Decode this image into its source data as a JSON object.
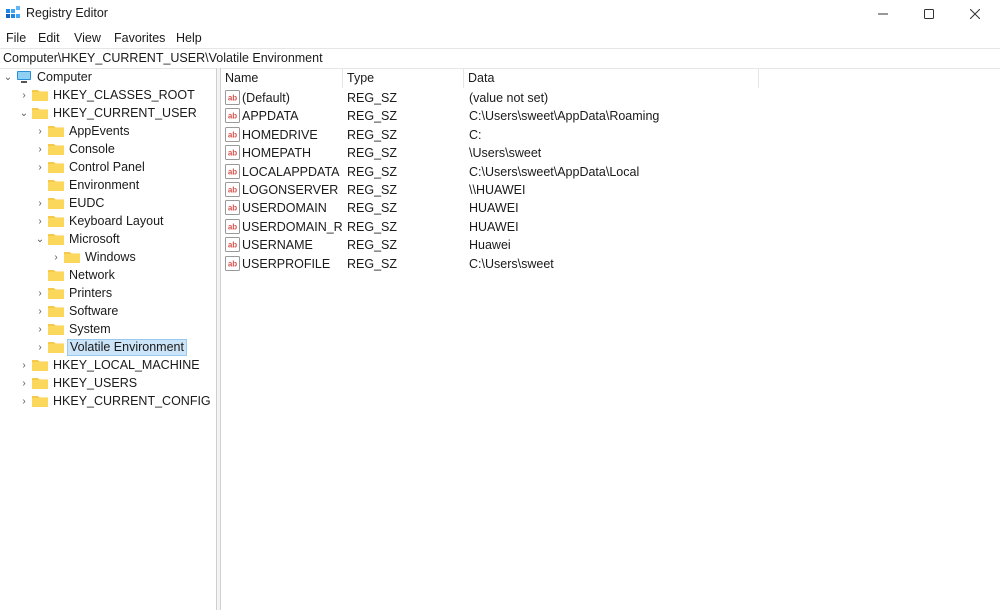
{
  "window": {
    "title": "Registry Editor"
  },
  "menu": {
    "file": "File",
    "edit": "Edit",
    "view": "View",
    "favorites": "Favorites",
    "help": "Help"
  },
  "address": "Computer\\HKEY_CURRENT_USER\\Volatile Environment",
  "tree": {
    "computer": "Computer",
    "hkcr": "HKEY_CLASSES_ROOT",
    "hkcu": "HKEY_CURRENT_USER",
    "appevents": "AppEvents",
    "console": "Console",
    "control_panel": "Control Panel",
    "environment": "Environment",
    "eudc": "EUDC",
    "keyboard_layout": "Keyboard Layout",
    "microsoft": "Microsoft",
    "windows": "Windows",
    "network": "Network",
    "printers": "Printers",
    "software": "Software",
    "system": "System",
    "volatile_environment": "Volatile Environment",
    "hklm": "HKEY_LOCAL_MACHINE",
    "hku": "HKEY_USERS",
    "hkcc": "HKEY_CURRENT_CONFIG"
  },
  "columns": {
    "name": "Name",
    "type": "Type",
    "data": "Data"
  },
  "values": [
    {
      "name": "(Default)",
      "type": "REG_SZ",
      "data": "(value not set)"
    },
    {
      "name": "APPDATA",
      "type": "REG_SZ",
      "data": "C:\\Users\\sweet\\AppData\\Roaming"
    },
    {
      "name": "HOMEDRIVE",
      "type": "REG_SZ",
      "data": "C:"
    },
    {
      "name": "HOMEPATH",
      "type": "REG_SZ",
      "data": "\\Users\\sweet"
    },
    {
      "name": "LOCALAPPDATA",
      "type": "REG_SZ",
      "data": "C:\\Users\\sweet\\AppData\\Local"
    },
    {
      "name": "LOGONSERVER",
      "type": "REG_SZ",
      "data": "\\\\HUAWEI"
    },
    {
      "name": "USERDOMAIN",
      "type": "REG_SZ",
      "data": "HUAWEI"
    },
    {
      "name": "USERDOMAIN_R...",
      "type": "REG_SZ",
      "data": "HUAWEI"
    },
    {
      "name": "USERNAME",
      "type": "REG_SZ",
      "data": "Huawei"
    },
    {
      "name": "USERPROFILE",
      "type": "REG_SZ",
      "data": "C:\\Users\\sweet"
    }
  ],
  "icons": {
    "app": "registry-editor-icon",
    "minimize": "minimize-icon",
    "maximize": "maximize-icon",
    "close": "close-icon",
    "folder": "folder-icon",
    "computer": "computer-icon",
    "string_value": "string-value-icon"
  },
  "colors": {
    "folder": "#f7c948",
    "selection": "#cce4f7",
    "selection_border": "#99c9ef",
    "string_icon": "#d9534f"
  }
}
